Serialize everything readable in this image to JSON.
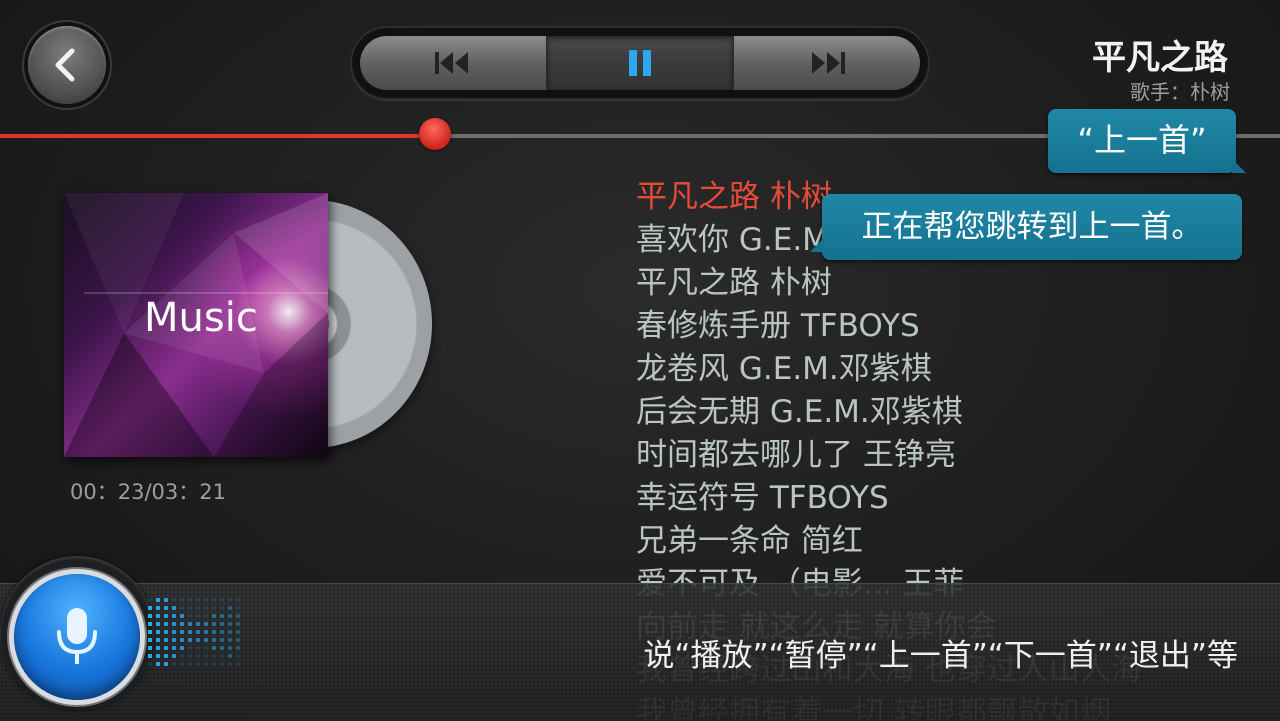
{
  "header": {
    "back_icon": "chevron-left-icon",
    "controls": [
      {
        "name": "previous",
        "icon": "skip-previous-icon"
      },
      {
        "name": "pause",
        "icon": "pause-icon",
        "accent": "#2aa9f0"
      },
      {
        "name": "next",
        "icon": "skip-next-icon"
      }
    ]
  },
  "now_playing": {
    "title": "平凡之路",
    "artist": "歌手：朴树",
    "progress": 0.34,
    "progress_color": "#e1352d"
  },
  "album": {
    "cover_label": "Music",
    "time": "00：23/03：21"
  },
  "playlist": [
    {
      "text": "平凡之路   朴树",
      "current": true
    },
    {
      "text": "喜欢你 G.E.M.邓紫棋"
    },
    {
      "text": "平凡之路 朴树"
    },
    {
      "text": "春修炼手册 TFBOYS"
    },
    {
      "text": "龙卷风 G.E.M.邓紫棋"
    },
    {
      "text": "后会无期 G.E.M.邓紫棋"
    },
    {
      "text": "时间都去哪儿了 王铮亮"
    },
    {
      "text": "幸运符号 TFBOYS"
    },
    {
      "text": "兄弟一条命 简红"
    },
    {
      "text": "爱不可及 （电影... 王菲"
    },
    {
      "text": "向前走 就这么走 就算你会"
    },
    {
      "text": "我曾经跨过山和大海 也穿过人山人海"
    },
    {
      "text": "我曾经拥有着一切 转眼都飘散如烟"
    }
  ],
  "bubbles": {
    "command": "“上一首”",
    "response": "正在帮您跳转到上一首。",
    "color": "#1a7e9c"
  },
  "voice": {
    "mic_icon": "microphone-icon",
    "hint": "说“播放”“暂停”“上一首”“下一首”“退出”等",
    "accent": "#2aa9f0"
  }
}
